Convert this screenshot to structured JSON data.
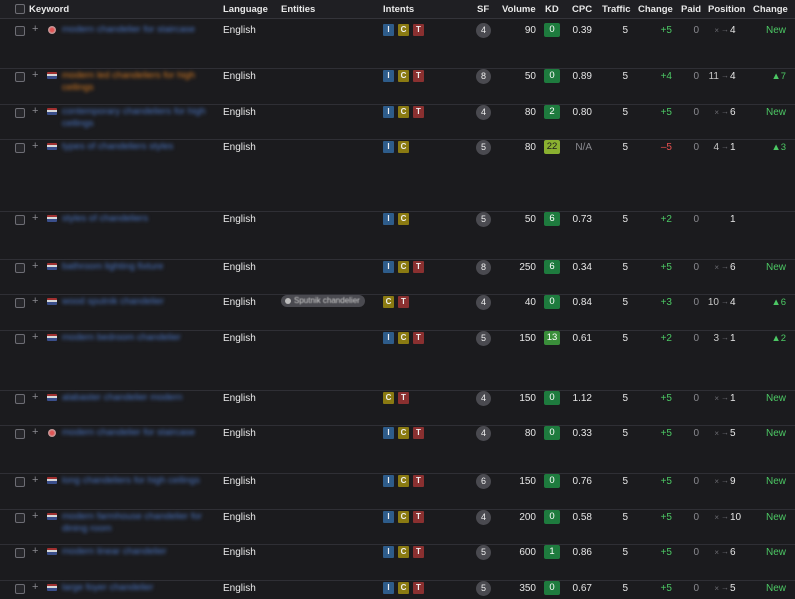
{
  "header": {
    "keyword": "Keyword",
    "language": "Language",
    "entities": "Entities",
    "intents": "Intents",
    "sf": "SF",
    "volume": "Volume",
    "kd": "KD",
    "cpc": "CPC",
    "traffic": "Traffic",
    "change": "Change",
    "paid": "Paid",
    "position": "Position",
    "change2": "Change"
  },
  "colors": {
    "intent_I": "#2e5c8a",
    "intent_C": "#8a7a12",
    "intent_T": "#8a3030",
    "kd_green": "#1e7b3e",
    "positive": "#4cc864",
    "negative": "#e85050"
  },
  "rows": [
    {
      "keyword": "modern chandelier for staircase",
      "flag": "round",
      "kw_color": "blue",
      "language": "English",
      "entity": "",
      "intents": [
        "I",
        "C",
        "T"
      ],
      "sf": "4",
      "volume": "90",
      "kd": "0",
      "cpc": "0.39",
      "traffic": "5",
      "change": "+5",
      "paid": "0",
      "pos_old": "×",
      "pos_new": "4",
      "change2": "New"
    },
    {
      "keyword": "modern led chandeliers for high ceilings",
      "flag": "rect",
      "kw_color": "orange",
      "language": "English",
      "entity": "",
      "intents": [
        "I",
        "C",
        "T"
      ],
      "sf": "8",
      "volume": "50",
      "kd": "0",
      "cpc": "0.89",
      "traffic": "5",
      "change": "+4",
      "paid": "0",
      "pos_old": "11",
      "pos_new": "4",
      "change2": "▲7"
    },
    {
      "keyword": "contemporary chandeliers for high ceilings",
      "flag": "rect",
      "kw_color": "blue",
      "language": "English",
      "entity": "",
      "intents": [
        "I",
        "C",
        "T"
      ],
      "sf": "4",
      "volume": "80",
      "kd": "2",
      "cpc": "0.80",
      "traffic": "5",
      "change": "+5",
      "paid": "0",
      "pos_old": "×",
      "pos_new": "6",
      "change2": "New"
    },
    {
      "keyword": "types of chandeliers styles",
      "flag": "rect",
      "kw_color": "blue",
      "language": "English",
      "entity": "",
      "intents": [
        "I",
        "C"
      ],
      "sf": "5",
      "volume": "80",
      "kd": "22",
      "cpc": "N/A",
      "traffic": "5",
      "change": "–5",
      "paid": "0",
      "pos_old": "4",
      "pos_new": "1",
      "change2": "▲3"
    },
    {
      "keyword": "styles of chandeliers",
      "flag": "rect",
      "kw_color": "blue",
      "language": "English",
      "entity": "",
      "intents": [
        "I",
        "C"
      ],
      "sf": "5",
      "volume": "50",
      "kd": "6",
      "cpc": "0.73",
      "traffic": "5",
      "change": "+2",
      "paid": "0",
      "pos_old": "",
      "pos_new": "1",
      "change2": ""
    },
    {
      "keyword": "bathroom lighting fixture",
      "flag": "rect",
      "kw_color": "blue",
      "language": "English",
      "entity": "",
      "intents": [
        "I",
        "C",
        "T"
      ],
      "sf": "8",
      "volume": "250",
      "kd": "6",
      "cpc": "0.34",
      "traffic": "5",
      "change": "+5",
      "paid": "0",
      "pos_old": "×",
      "pos_new": "6",
      "change2": "New"
    },
    {
      "keyword": "wood sputnik chandelier",
      "flag": "rect",
      "kw_color": "blue",
      "language": "English",
      "entity": "Sputnik chandelier",
      "intents": [
        "C",
        "T"
      ],
      "sf": "4",
      "volume": "40",
      "kd": "0",
      "cpc": "0.84",
      "traffic": "5",
      "change": "+3",
      "paid": "0",
      "pos_old": "10",
      "pos_new": "4",
      "change2": "▲6"
    },
    {
      "keyword": "modern bedroom chandelier",
      "flag": "rect",
      "kw_color": "blue",
      "language": "English",
      "entity": "",
      "intents": [
        "I",
        "C",
        "T"
      ],
      "sf": "5",
      "volume": "150",
      "kd": "13",
      "cpc": "0.61",
      "traffic": "5",
      "change": "+2",
      "paid": "0",
      "pos_old": "3",
      "pos_new": "1",
      "change2": "▲2"
    },
    {
      "keyword": "alabaster chandelier modern",
      "flag": "rect",
      "kw_color": "blue",
      "language": "English",
      "entity": "",
      "intents": [
        "C",
        "T"
      ],
      "sf": "4",
      "volume": "150",
      "kd": "0",
      "cpc": "1.12",
      "traffic": "5",
      "change": "+5",
      "paid": "0",
      "pos_old": "×",
      "pos_new": "1",
      "change2": "New"
    },
    {
      "keyword": "modern chandelier for staircase",
      "flag": "round",
      "kw_color": "blue",
      "language": "English",
      "entity": "",
      "intents": [
        "I",
        "C",
        "T"
      ],
      "sf": "4",
      "volume": "80",
      "kd": "0",
      "cpc": "0.33",
      "traffic": "5",
      "change": "+5",
      "paid": "0",
      "pos_old": "×",
      "pos_new": "5",
      "change2": "New"
    },
    {
      "keyword": "long chandeliers for high ceilings",
      "flag": "rect",
      "kw_color": "blue",
      "language": "English",
      "entity": "",
      "intents": [
        "I",
        "C",
        "T"
      ],
      "sf": "6",
      "volume": "150",
      "kd": "0",
      "cpc": "0.76",
      "traffic": "5",
      "change": "+5",
      "paid": "0",
      "pos_old": "×",
      "pos_new": "9",
      "change2": "New"
    },
    {
      "keyword": "modern farmhouse chandelier for dining room",
      "flag": "rect",
      "kw_color": "blue",
      "language": "English",
      "entity": "",
      "intents": [
        "I",
        "C",
        "T"
      ],
      "sf": "4",
      "volume": "200",
      "kd": "0",
      "cpc": "0.58",
      "traffic": "5",
      "change": "+5",
      "paid": "0",
      "pos_old": "×",
      "pos_new": "10",
      "change2": "New"
    },
    {
      "keyword": "modern linear chandelier",
      "flag": "rect",
      "kw_color": "blue",
      "language": "English",
      "entity": "",
      "intents": [
        "I",
        "C",
        "T"
      ],
      "sf": "5",
      "volume": "600",
      "kd": "1",
      "cpc": "0.86",
      "traffic": "5",
      "change": "+5",
      "paid": "0",
      "pos_old": "×",
      "pos_new": "6",
      "change2": "New"
    },
    {
      "keyword": "large foyer chandelier",
      "flag": "rect",
      "kw_color": "blue",
      "language": "English",
      "entity": "",
      "intents": [
        "I",
        "C",
        "T"
      ],
      "sf": "5",
      "volume": "350",
      "kd": "0",
      "cpc": "0.67",
      "traffic": "5",
      "change": "+5",
      "paid": "0",
      "pos_old": "×",
      "pos_new": "5",
      "change2": "New"
    }
  ]
}
